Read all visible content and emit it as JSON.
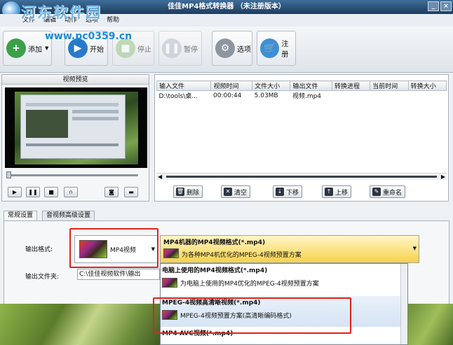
{
  "window": {
    "title": "佳佳MP4格式转换器 （未注册版本）"
  },
  "watermark": {
    "site_cn": "河东软件园",
    "site_url": "www.pc0359.cn"
  },
  "menu": {
    "items": [
      "文件",
      "编辑",
      "动作",
      "选项",
      "帮助"
    ]
  },
  "toolbar": {
    "add_label": "添加",
    "start_label": "开始",
    "stop_label": "停止",
    "pause_label": "暂停",
    "options_label": "选项",
    "register_label": "注册"
  },
  "preview": {
    "title": "视频预览",
    "seek_percent": 0
  },
  "file_table": {
    "columns": [
      "输入文件",
      "视频时间",
      "文件大小",
      "输出文件",
      "转换进程",
      "当前时间",
      "转换大小"
    ],
    "rows": [
      [
        "D:\\tools\\桌...",
        "00:00:44",
        "5.03MB",
        "视频.mp4",
        "",
        "",
        ""
      ]
    ]
  },
  "actions": {
    "delete_label": "删除",
    "clear_label": "清空",
    "down_label": "下移",
    "up_label": "上移",
    "rename_label": "重命名"
  },
  "tabs": [
    "常规设置",
    "音视频高级设置"
  ],
  "settings": {
    "format_label": "输出格式:",
    "format_value": "MP4视频",
    "folder_label": "输出文件夹:",
    "folder_value": "C:\\佳佳视频软件\\输出",
    "profile_title": "MP4机器的MP4视频格式(*.mp4)",
    "profile_desc": "为各种MP4机优化的MPEG-4视频预置方案"
  },
  "dropdown": {
    "items": [
      {
        "title": "电脑上使用的MP4视频格式(*.mp4)",
        "desc": "为电脑上使用的MP4优化的MPEG-4视频预置方案"
      },
      {
        "title": "MPEG-4视频高清晰视频(*.mp4)",
        "desc": "MPEG-4视频预置方案(高清晰编码格式)"
      },
      {
        "title": "MP4 AVC视频(*.mp4)",
        "desc": ""
      }
    ]
  },
  "colors": {
    "highlight_red": "#e0241b",
    "title_bar": "#2f5d88"
  }
}
